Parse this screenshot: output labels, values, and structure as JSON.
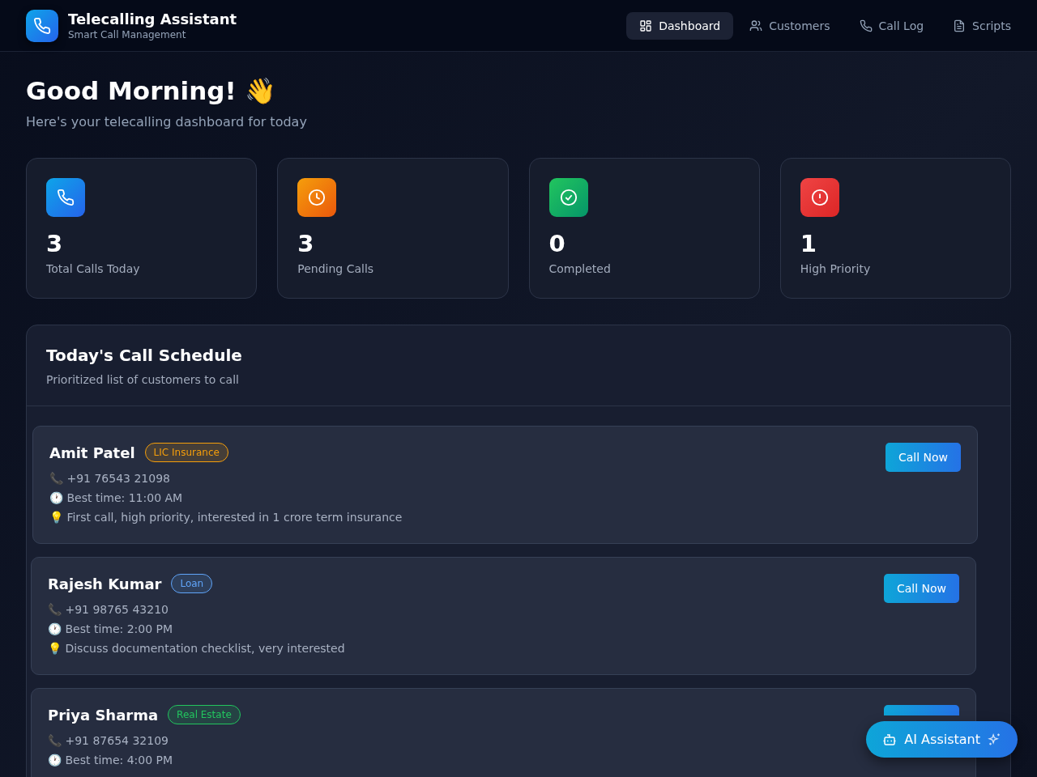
{
  "app": {
    "title": "Telecalling Assistant",
    "subtitle": "Smart Call Management"
  },
  "nav": [
    {
      "label": "Dashboard",
      "kind": "grid",
      "selected": true
    },
    {
      "label": "Customers",
      "kind": "users",
      "selected": false
    },
    {
      "label": "Call Log",
      "kind": "phone",
      "selected": false
    },
    {
      "label": "Scripts",
      "kind": "doc",
      "selected": false
    }
  ],
  "greeting": {
    "title": "Good Morning! 👋",
    "subtitle": "Here's your telecalling dashboard for today"
  },
  "stats": [
    {
      "value": "3",
      "label": "Total Calls Today",
      "kind": "phone"
    },
    {
      "value": "3",
      "label": "Pending Calls",
      "kind": "clock"
    },
    {
      "value": "0",
      "label": "Completed",
      "kind": "check"
    },
    {
      "value": "1",
      "label": "High Priority",
      "kind": "alert"
    }
  ],
  "schedule": {
    "title": "Today's Call Schedule",
    "subtitle": "Prioritized list of customers to call",
    "items": [
      {
        "name": "Amit Patel",
        "tag": "LIC Insurance",
        "color": "#f59e0b",
        "phone": "📞 +91 76543 21098",
        "time": "🕐 Best time: 11:00 AM",
        "note": "💡 First call, high priority, interested in 1 crore term insurance",
        "button": "Call Now"
      },
      {
        "name": "Rajesh Kumar",
        "tag": "Loan",
        "color": "#60a5fa",
        "phone": "📞 +91 98765 43210",
        "time": "🕐 Best time: 2:00 PM",
        "note": "💡 Discuss documentation checklist, very interested",
        "button": "Call Now"
      },
      {
        "name": "Priya Sharma",
        "tag": "Real Estate",
        "color": "#22c55e",
        "phone": "📞 +91 87654 32109",
        "time": "🕐 Best time: 4:00 PM"
      }
    ]
  },
  "assistant_button": {
    "label": "AI Assistant"
  }
}
